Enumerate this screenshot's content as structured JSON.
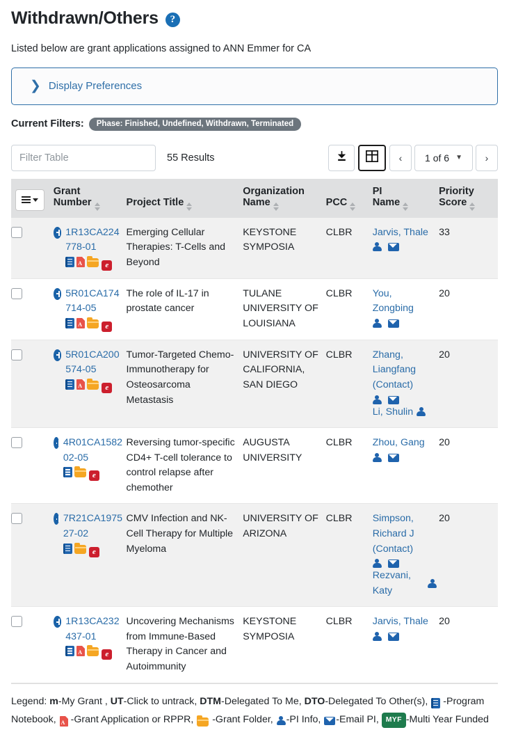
{
  "page": {
    "title": "Withdrawn/Others",
    "help_icon": "question-mark-circle-icon",
    "intro": "Listed below are grant applications assigned to ANN Emmer for CA"
  },
  "display_preferences": {
    "label": "Display Preferences",
    "chevron": "chevron-right-icon",
    "expanded": false
  },
  "current_filters": {
    "label": "Current Filters:",
    "pills": [
      "Phase: Finished, Undefined, Withdrawn, Terminated"
    ]
  },
  "toolbar": {
    "filter_placeholder": "Filter Table",
    "filter_value": "",
    "results_text": "55 Results",
    "download_icon": "download-icon",
    "columns_icon": "table-grid-icon",
    "prev_label": "‹",
    "next_label": "›",
    "page_label": "1 of 6",
    "page_caret": "chevron-down-icon"
  },
  "table": {
    "menu_button": "column-menu-button",
    "columns": [
      {
        "key": "menu",
        "label": ""
      },
      {
        "key": "grant",
        "label_top": "Grant",
        "label": "Number",
        "sortable": true
      },
      {
        "key": "title",
        "label_top": "",
        "label": "Project Title",
        "sortable": true
      },
      {
        "key": "org",
        "label_top": "Organization",
        "label": "Name",
        "sortable": true
      },
      {
        "key": "pcc",
        "label_top": "",
        "label": "PCC",
        "sortable": true
      },
      {
        "key": "pi",
        "label_top": "PI",
        "label": "Name",
        "sortable": true
      },
      {
        "key": "score",
        "label_top": "Priority",
        "label": "Score",
        "sortable": true
      }
    ],
    "rows": [
      {
        "grant_number": "1R13CA224778-01",
        "icons": [
          "notebook",
          "pdf",
          "folder",
          "era"
        ],
        "icons_inline": false,
        "project_title": "Emerging Cellular Therapies: T-Cells and Beyond",
        "org_name": "KEYSTONE SYMPOSIA",
        "pcc": "CLBR",
        "pi": [
          {
            "name": "Jarvis, Thale",
            "contact": false,
            "icons": [
              "person",
              "mail"
            ]
          }
        ],
        "priority_score": "33"
      },
      {
        "grant_number": "5R01CA174714-05",
        "icons": [
          "notebook",
          "pdf",
          "folder",
          "era"
        ],
        "icons_inline": false,
        "project_title": "The role of IL-17 in prostate cancer",
        "org_name": "TULANE UNIVERSITY OF LOUISIANA",
        "pcc": "CLBR",
        "pi": [
          {
            "name": "You, Zongbing",
            "contact": false,
            "icons": [
              "person",
              "mail"
            ]
          }
        ],
        "priority_score": "20"
      },
      {
        "grant_number": "5R01CA200574-05",
        "icons": [
          "notebook",
          "pdf",
          "folder",
          "era"
        ],
        "icons_inline": false,
        "project_title": "Tumor-Targeted Chemo-Immunotherapy for Osteosarcoma Metastasis",
        "org_name": "UNIVERSITY OF CALIFORNIA, SAN DIEGO",
        "pcc": "CLBR",
        "pi": [
          {
            "name": "Zhang, Liangfang (Contact)",
            "contact": true,
            "icons": [
              "person",
              "mail"
            ]
          },
          {
            "name": "Li, Shulin",
            "contact": false,
            "icons": [
              "person"
            ],
            "inline": true
          }
        ],
        "priority_score": "20"
      },
      {
        "grant_number": "4R01CA158202-05",
        "icons": [
          "notebook",
          "folder",
          "era"
        ],
        "icons_inline": true,
        "project_title": "Reversing tumor-specific CD4+ T-cell tolerance to control relapse after chemother",
        "org_name": "AUGUSTA UNIVERSITY",
        "pcc": "CLBR",
        "pi": [
          {
            "name": "Zhou, Gang",
            "contact": false,
            "icons": [
              "person",
              "mail"
            ]
          }
        ],
        "priority_score": "20"
      },
      {
        "grant_number": "7R21CA197527-02",
        "icons": [
          "notebook",
          "folder",
          "era"
        ],
        "icons_inline": true,
        "project_title": "CMV Infection and NK-Cell Therapy for Multiple Myeloma",
        "org_name": "UNIVERSITY OF ARIZONA",
        "pcc": "CLBR",
        "pi": [
          {
            "name": "Simpson, Richard J (Contact)",
            "contact": true,
            "icons": [
              "person",
              "mail"
            ]
          },
          {
            "name": "Rezvani, Katy",
            "contact": false,
            "icons": [
              "person"
            ],
            "inline": true
          }
        ],
        "priority_score": "20"
      },
      {
        "grant_number": "1R13CA232437-01",
        "icons": [
          "notebook",
          "pdf",
          "folder",
          "era"
        ],
        "icons_inline": false,
        "project_title": "Uncovering Mechanisms from Immune-Based Therapy in Cancer and Autoimmunity",
        "org_name": "KEYSTONE SYMPOSIA",
        "pcc": "CLBR",
        "pi": [
          {
            "name": "Jarvis, Thale",
            "contact": false,
            "icons": [
              "person",
              "mail"
            ]
          }
        ],
        "priority_score": "20"
      }
    ]
  },
  "legend": {
    "prefix": "Legend: ",
    "items": [
      {
        "key": "m",
        "bold": true,
        "text": "-My Grant , "
      },
      {
        "key": "UT",
        "bold": true,
        "text": "-Click to untrack, "
      },
      {
        "key": "DTM",
        "bold": true,
        "text": "-Delegated To Me, "
      },
      {
        "key": "DTO",
        "bold": true,
        "text": "-Delegated To Other(s), "
      }
    ],
    "icon_items": [
      {
        "icon": "notebook",
        "text": "-Program Notebook, "
      },
      {
        "icon": "pdf",
        "text": "-Grant Application or RPPR, "
      },
      {
        "icon": "folder",
        "text": "-Grant Folder, "
      },
      {
        "icon": "person",
        "text": "-PI Info, "
      },
      {
        "icon": "mail",
        "text": "-Email PI, "
      },
      {
        "icon": "myf-badge",
        "badge": "MYF",
        "text": "-Multi Year Funded"
      }
    ]
  },
  "colors": {
    "link": "#2a6ca8",
    "header_bg": "#dfe0e1",
    "alt_row_bg": "#f1f1f1",
    "pill_bg": "#6c757d",
    "accent_blue": "#1a6fb5",
    "myf_green": "#1e7b4d",
    "pdf_red": "#e8534a",
    "folder_orange": "#f5a623",
    "era_red": "#cc1f2d"
  }
}
